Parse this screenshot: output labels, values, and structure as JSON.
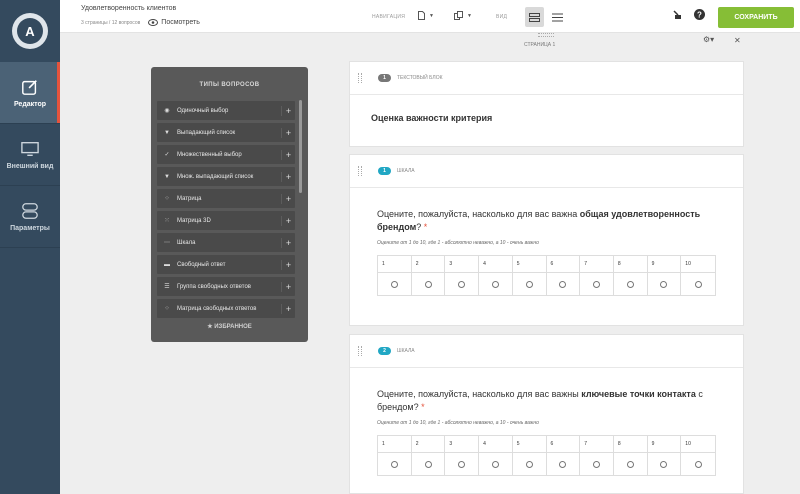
{
  "app": {
    "logo_letter": "A",
    "rail": [
      {
        "label": "Редактор",
        "icon": "edit-icon",
        "active": true
      },
      {
        "label": "Внешний вид",
        "icon": "monitor-icon",
        "active": false
      },
      {
        "label": "Параметры",
        "icon": "toggles-icon",
        "active": false
      }
    ]
  },
  "topbar": {
    "title": "Удовлетворенность клиентов",
    "meta": "3 страницы / 12 вопросов",
    "preview_label": "Посмотреть",
    "navigation_label": "НАВИГАЦИЯ",
    "view_label": "ВИД",
    "save_label": "СОХРАНИТЬ",
    "accent_color": "#86be36"
  },
  "panel": {
    "title": "ТИПЫ ВОПРОСОВ",
    "items": [
      {
        "label": "Одиночный выбор",
        "icon": "radio-icon"
      },
      {
        "label": "Выпадающий список",
        "icon": "dropdown-icon"
      },
      {
        "label": "Множественный выбор",
        "icon": "check-icon"
      },
      {
        "label": "Множ. выпадающий список",
        "icon": "dropdown-icon"
      },
      {
        "label": "Матрица",
        "icon": "matrix-icon"
      },
      {
        "label": "Матрица 3D",
        "icon": "matrix-3d-icon"
      },
      {
        "label": "Шкала",
        "icon": "scale-icon"
      },
      {
        "label": "Свободный ответ",
        "icon": "text-icon"
      },
      {
        "label": "Группа свободных ответов",
        "icon": "text-group-icon"
      },
      {
        "label": "Матрица свободных ответов",
        "icon": "matrix-icon"
      }
    ],
    "favorites_label": "★ ИЗБРАННОЕ"
  },
  "page": {
    "label": "СТРАНИЦА 1"
  },
  "blocks": [
    {
      "badge": "1",
      "type_label": "ТЕКСТОВЫЙ БЛОК",
      "text": "Оценка важности критерия"
    },
    {
      "badge": "1",
      "type_label": "ШКАЛА",
      "question_pre": "Оцените, пожалуйста, насколько для вас важна ",
      "question_bold": "общая удовлетворенность брендом",
      "question_post": "?",
      "required_mark": "*",
      "hint": "Оцените от 1 до 10, где 1 - абсолютно неважно, а 10 - очень важно",
      "scale": [
        "1",
        "2",
        "3",
        "4",
        "5",
        "6",
        "7",
        "8",
        "9",
        "10"
      ]
    },
    {
      "badge": "2",
      "type_label": "ШКАЛА",
      "question_pre": "Оцените, пожалуйста, насколько для вас важны ",
      "question_bold": "ключевые точки контакта",
      "question_post": " с брендом?",
      "required_mark": "*",
      "hint": "Оцените от 1 до 10, где 1 - абсолютно неважно, а 10 - очень важно",
      "scale": [
        "1",
        "2",
        "3",
        "4",
        "5",
        "6",
        "7",
        "8",
        "9",
        "10"
      ]
    }
  ]
}
